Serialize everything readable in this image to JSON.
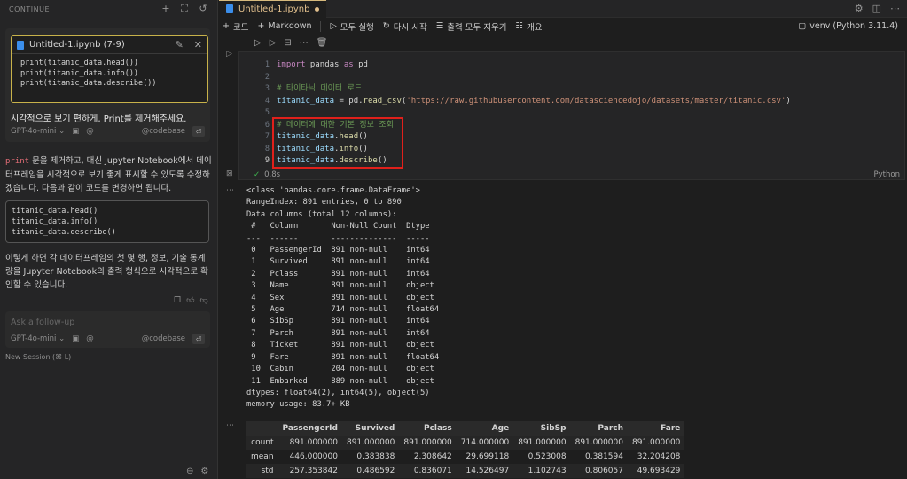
{
  "sidebar": {
    "title": "CONTINUE",
    "context": {
      "file_label": "Untitled-1.ipynb (7-9)",
      "code_lines": [
        "print(titanic_data.head())",
        "print(titanic_data.info())",
        "print(titanic_data.describe())"
      ],
      "message": "시각적으로 보기 편하게, Print를 제거해주세요.",
      "model": "GPT-4o-mini",
      "codebase": "@codebase"
    },
    "response": {
      "keyword": "print",
      "paragraph1": " 문을 제거하고, 대신 Jupyter Notebook에서 데이터프레임을 시각적으로 보기 좋게 표시할 수 있도록 수정하겠습니다. 다음과 같이 코드를 변경하면 됩니다.",
      "code_lines": [
        "titanic_data.head()",
        "titanic_data.info()",
        "titanic_data.describe()"
      ],
      "paragraph2": "이렇게 하면 각 데이터프레임의 첫 몇 행, 정보, 기술 통계량을 Jupyter Notebook의 출력 형식으로 시각적으로 확인할 수 있습니다."
    },
    "followup": {
      "placeholder": "Ask a follow-up",
      "model": "GPT-4o-mini",
      "codebase": "@codebase"
    },
    "new_session": "New Session (⌘ L)"
  },
  "tab": {
    "name": "Untitled-1.ipynb"
  },
  "toolbar": {
    "code": "코드",
    "markdown": "Markdown",
    "run_all": "모두 실행",
    "restart": "다시 시작",
    "clear_outputs": "출력 모두 지우기",
    "outline": "개요",
    "kernel": "venv (Python 3.11.4)"
  },
  "cell": {
    "line_numbers": [
      "1",
      "2",
      "3",
      "4",
      "5",
      "6",
      "7",
      "8",
      "9"
    ],
    "exec_time": "0.8s",
    "language": "Python"
  },
  "output": {
    "info_lines": [
      "<class 'pandas.core.frame.DataFrame'>",
      "RangeIndex: 891 entries, 0 to 890",
      "Data columns (total 12 columns):",
      " #   Column       Non-Null Count  Dtype  ",
      "---  ------       --------------  -----  ",
      " 0   PassengerId  891 non-null    int64  ",
      " 1   Survived     891 non-null    int64  ",
      " 2   Pclass       891 non-null    int64  ",
      " 3   Name         891 non-null    object ",
      " 4   Sex          891 non-null    object ",
      " 5   Age          714 non-null    float64",
      " 6   SibSp        891 non-null    int64  ",
      " 7   Parch        891 non-null    int64  ",
      " 8   Ticket       891 non-null    object ",
      " 9   Fare         891 non-null    float64",
      " 10  Cabin        204 non-null    object ",
      " 11  Embarked     889 non-null    object ",
      "dtypes: float64(2), int64(5), object(5)",
      "memory usage: 83.7+ KB"
    ],
    "describe_columns": [
      "",
      "PassengerId",
      "Survived",
      "Pclass",
      "Age",
      "SibSp",
      "Parch",
      "Fare"
    ],
    "describe_rows": [
      [
        "count",
        "891.000000",
        "891.000000",
        "891.000000",
        "714.000000",
        "891.000000",
        "891.000000",
        "891.000000"
      ],
      [
        "mean",
        "446.000000",
        "0.383838",
        "2.308642",
        "29.699118",
        "0.523008",
        "0.381594",
        "32.204208"
      ],
      [
        "std",
        "257.353842",
        "0.486592",
        "0.836071",
        "14.526497",
        "1.102743",
        "0.806057",
        "49.693429"
      ]
    ]
  }
}
